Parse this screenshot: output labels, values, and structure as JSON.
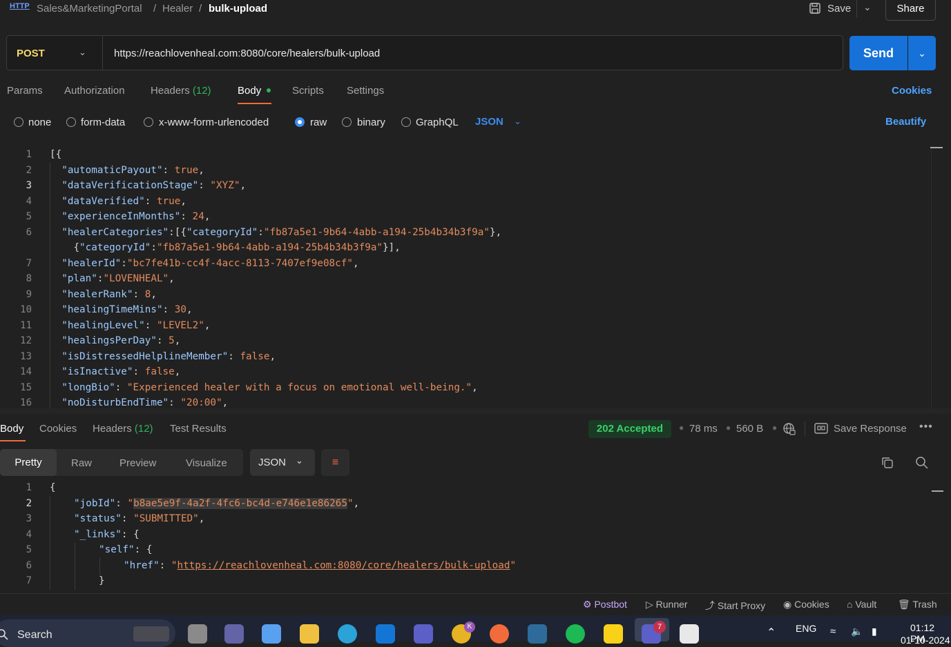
{
  "breadcrumb": {
    "collection": "Sales&MarketingPortal",
    "sep1": "/",
    "folder": "Healer",
    "sep2": "/",
    "request": "bulk-upload",
    "method_icon": "HTTP"
  },
  "top_actions": {
    "save": "Save",
    "share": "Share"
  },
  "request": {
    "method": "POST",
    "url": "https://reachlovenheal.com:8080/core/healers/bulk-upload",
    "send": "Send"
  },
  "req_tabs": {
    "params": "Params",
    "authorization": "Authorization",
    "headers": "Headers",
    "headers_count": "(12)",
    "body": "Body",
    "scripts": "Scripts",
    "settings": "Settings",
    "cookies": "Cookies"
  },
  "body_types": {
    "none": "none",
    "form_data": "form-data",
    "urlencoded": "x-www-form-urlencoded",
    "raw": "raw",
    "binary": "binary",
    "graphql": "GraphQL",
    "format": "JSON",
    "beautify": "Beautify",
    "selected": "raw"
  },
  "request_body_lines": [
    {
      "n": "1",
      "t": "[{"
    },
    {
      "n": "2",
      "t": "  \"automaticPayout\": true,"
    },
    {
      "n": "3",
      "t": "  \"dataVerificationStage\": \"XYZ\","
    },
    {
      "n": "4",
      "t": "  \"dataVerified\": true,"
    },
    {
      "n": "5",
      "t": "  \"experienceInMonths\": 24,"
    },
    {
      "n": "6",
      "t": "  \"healerCategories\":[{\"categoryId\":\"fb87a5e1-9b64-4abb-a194-25b4b34b3f9a\"},"
    },
    {
      "n": "",
      "t": "    {\"categoryId\":\"fb87a5e1-9b64-4abb-a194-25b4b34b3f9a\"}],"
    },
    {
      "n": "7",
      "t": "  \"healerId\":\"bc7fe41b-cc4f-4acc-8113-7407ef9e08cf\","
    },
    {
      "n": "8",
      "t": "  \"plan\":\"LOVENHEAL\","
    },
    {
      "n": "9",
      "t": "  \"healerRank\": 8,"
    },
    {
      "n": "10",
      "t": "  \"healingTimeMins\": 30,"
    },
    {
      "n": "11",
      "t": "  \"healingLevel\": \"LEVEL2\","
    },
    {
      "n": "12",
      "t": "  \"healingsPerDay\": 5,"
    },
    {
      "n": "13",
      "t": "  \"isDistressedHelplineMember\": false,"
    },
    {
      "n": "14",
      "t": "  \"isInactive\": false,"
    },
    {
      "n": "15",
      "t": "  \"longBio\": \"Experienced healer with a focus on emotional well-being.\","
    },
    {
      "n": "16",
      "t": "  \"noDisturbEndTime\": \"20:00\","
    }
  ],
  "res_tabs": {
    "body": "Body",
    "cookies": "Cookies",
    "headers": "Headers",
    "headers_count": "(12)",
    "tests": "Test Results"
  },
  "response_meta": {
    "status": "202 Accepted",
    "time": "78 ms",
    "size": "560 B",
    "save_response": "Save Response"
  },
  "view_tabs": {
    "pretty": "Pretty",
    "raw": "Raw",
    "preview": "Preview",
    "visualize": "Visualize",
    "format": "JSON"
  },
  "response_body": {
    "l1": "{",
    "jobId_key": "\"jobId\"",
    "jobId_val": "b8ae5e9f-4a2f-4fc6-bc4d-e746e1e86265",
    "status_key": "\"status\"",
    "status_val": "\"SUBMITTED\"",
    "links_key": "\"_links\"",
    "self_key": "\"self\"",
    "href_key": "\"href\"",
    "href_val": "https://reachlovenheal.com:8080/core/healers/bulk-upload",
    "close": "}"
  },
  "footer": {
    "postbot": "Postbot",
    "runner": "Runner",
    "proxy": "Start Proxy",
    "cookies": "Cookies",
    "vault": "Vault",
    "trash": "Trash"
  },
  "taskbar": {
    "search": "Search",
    "lang": "ENG",
    "time": "01:12 PM",
    "date": "01-10-2024",
    "teams_badge": "7",
    "chrome_badge": "K"
  },
  "colors": {
    "accent": "#1672d8",
    "send": "#1672d8",
    "status_ok": "#3ccf6a",
    "method": "#f5d86a",
    "active_underline": "#f26b3a"
  }
}
